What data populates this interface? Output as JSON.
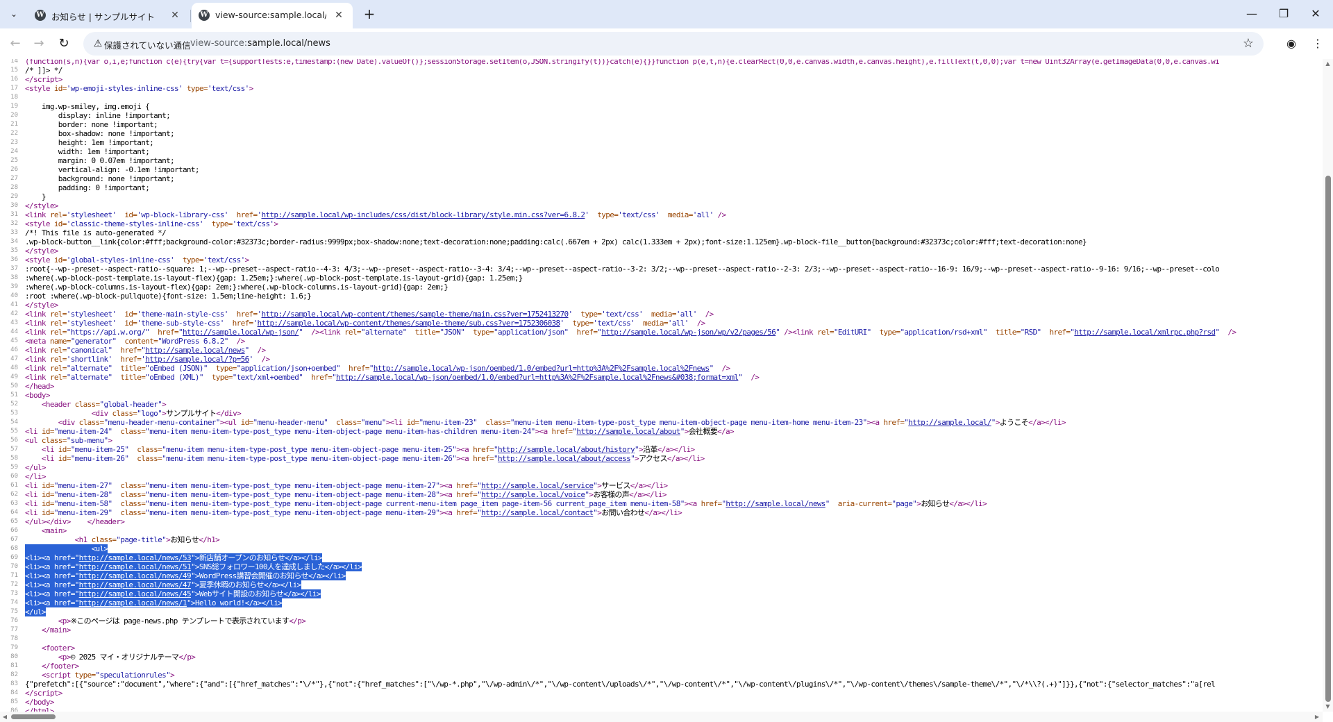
{
  "tabs": [
    {
      "title": "お知らせ | サンプルサイト",
      "favicon": "wordpress-icon",
      "active": false
    },
    {
      "title": "view-source:sample.local/news",
      "favicon": "wordpress-icon",
      "active": true
    }
  ],
  "toolbar": {
    "security_label": "保護されていない通信",
    "url_prefix": "view-source:",
    "url_host": "sample.local/news",
    "icons": [
      "back-icon",
      "forward-icon",
      "reload-icon",
      "warning-icon",
      "bookmark-star-icon",
      "profile-icon",
      "menu-icon"
    ]
  },
  "source_lines": [
    {
      "n": "14",
      "html": "<span class=\"tg\">(function(s,n){var o,i,e;function c(e){try{var t={supportTests:e,timestamp:(new Date).valueOf()};sessionStorage.setItem(o,JSON.stringify(t))}catch(e){}}function p(e,t,n){e.clearRect(0,0,e.canvas.width,e.canvas.height),e.fillText(t,0,0);var t=new Uint32Array(e.getImageData(0,0,e.canvas.wi</span>"
    },
    {
      "n": "15",
      "html": "/* ]]> */"
    },
    {
      "n": "16",
      "html": "<span class=\"tg\">&lt;/script&gt;</span>"
    },
    {
      "n": "17",
      "html": "<span class=\"tg\">&lt;style </span><span class=\"at\">id=</span><span class=\"av\">'wp-emoji-styles-inline-css'</span> <span class=\"at\">type=</span><span class=\"av\">'text/css'</span><span class=\"tg\">&gt;</span>"
    },
    {
      "n": "18",
      "html": ""
    },
    {
      "n": "19",
      "html": "    img.wp-smiley, img.emoji {"
    },
    {
      "n": "20",
      "html": "        display: inline !important;"
    },
    {
      "n": "21",
      "html": "        border: none !important;"
    },
    {
      "n": "22",
      "html": "        box-shadow: none !important;"
    },
    {
      "n": "23",
      "html": "        height: 1em !important;"
    },
    {
      "n": "24",
      "html": "        width: 1em !important;"
    },
    {
      "n": "25",
      "html": "        margin: 0 0.07em !important;"
    },
    {
      "n": "26",
      "html": "        vertical-align: -0.1em !important;"
    },
    {
      "n": "27",
      "html": "        background: none !important;"
    },
    {
      "n": "28",
      "html": "        padding: 0 !important;"
    },
    {
      "n": "29",
      "html": "    }"
    },
    {
      "n": "30",
      "html": "<span class=\"tg\">&lt;/style&gt;</span>"
    },
    {
      "n": "31",
      "html": "<span class=\"tg\">&lt;link </span><span class=\"at\">rel=</span><span class=\"av\">'stylesheet'</span>  <span class=\"at\">id=</span><span class=\"av\">'wp-block-library-css'</span>  <span class=\"at\">href=</span><span class=\"av\">'</span><span class=\"lk\">http://sample.local/wp-includes/css/dist/block-library/style.min.css?ver=6.8.2</span><span class=\"av\">'</span>  <span class=\"at\">type=</span><span class=\"av\">'text/css'</span>  <span class=\"at\">media=</span><span class=\"av\">'all'</span> <span class=\"tg\">/&gt;</span>"
    },
    {
      "n": "32",
      "html": "<span class=\"tg\">&lt;style </span><span class=\"at\">id=</span><span class=\"av\">'classic-theme-styles-inline-css'</span>  <span class=\"at\">type=</span><span class=\"av\">'text/css'</span><span class=\"tg\">&gt;</span>"
    },
    {
      "n": "33",
      "html": "/*! This file is auto-generated */"
    },
    {
      "n": "34",
      "html": ".wp-block-button__link{color:#fff;background-color:#32373c;border-radius:9999px;box-shadow:none;text-decoration:none;padding:calc(.667em + 2px) calc(1.333em + 2px);font-size:1.125em}.wp-block-file__button{background:#32373c;color:#fff;text-decoration:none}"
    },
    {
      "n": "35",
      "html": "<span class=\"tg\">&lt;/style&gt;</span>"
    },
    {
      "n": "36",
      "html": "<span class=\"tg\">&lt;style </span><span class=\"at\">id=</span><span class=\"av\">'global-styles-inline-css'</span>  <span class=\"at\">type=</span><span class=\"av\">'text/css'</span><span class=\"tg\">&gt;</span>"
    },
    {
      "n": "37",
      "html": ":root{--wp--preset--aspect-ratio--square: 1;--wp--preset--aspect-ratio--4-3: 4/3;--wp--preset--aspect-ratio--3-4: 3/4;--wp--preset--aspect-ratio--3-2: 3/2;--wp--preset--aspect-ratio--2-3: 2/3;--wp--preset--aspect-ratio--16-9: 16/9;--wp--preset--aspect-ratio--9-16: 9/16;--wp--preset--colo"
    },
    {
      "n": "38",
      "html": ":where(.wp-block-post-template.is-layout-flex){gap: 1.25em;}:where(.wp-block-post-template.is-layout-grid){gap: 1.25em;}"
    },
    {
      "n": "39",
      "html": ":where(.wp-block-columns.is-layout-flex){gap: 2em;}:where(.wp-block-columns.is-layout-grid){gap: 2em;}"
    },
    {
      "n": "40",
      "html": ":root :where(.wp-block-pullquote){font-size: 1.5em;line-height: 1.6;}"
    },
    {
      "n": "41",
      "html": "<span class=\"tg\">&lt;/style&gt;</span>"
    },
    {
      "n": "42",
      "html": "<span class=\"tg\">&lt;link </span><span class=\"at\">rel=</span><span class=\"av\">'stylesheet'</span>  <span class=\"at\">id=</span><span class=\"av\">'theme-main-style-css'</span>  <span class=\"at\">href=</span><span class=\"av\">'</span><span class=\"lk\">http://sample.local/wp-content/themes/sample-theme/main.css?ver=1752413270</span><span class=\"av\">'</span>  <span class=\"at\">type=</span><span class=\"av\">'text/css'</span>  <span class=\"at\">media=</span><span class=\"av\">'all'</span>  <span class=\"tg\">/&gt;</span>"
    },
    {
      "n": "43",
      "html": "<span class=\"tg\">&lt;link </span><span class=\"at\">rel=</span><span class=\"av\">'stylesheet'</span>  <span class=\"at\">id=</span><span class=\"av\">'theme-sub-style-css'</span>  <span class=\"at\">href=</span><span class=\"av\">'</span><span class=\"lk\">http://sample.local/wp-content/themes/sample-theme/sub.css?ver=1752306038</span><span class=\"av\">'</span>  <span class=\"at\">type=</span><span class=\"av\">'text/css'</span>  <span class=\"at\">media=</span><span class=\"av\">'all'</span>  <span class=\"tg\">/&gt;</span>"
    },
    {
      "n": "44",
      "html": "<span class=\"tg\">&lt;link </span><span class=\"at\">rel=</span><span class=\"av\">\"https://api.w.org/\"</span>  <span class=\"at\">href=</span><span class=\"av\">\"</span><span class=\"lk\">http://sample.local/wp-json/</span><span class=\"av\">\"</span>  <span class=\"tg\">/&gt;&lt;link </span><span class=\"at\">rel=</span><span class=\"av\">\"alternate\"</span>  <span class=\"at\">title=</span><span class=\"av\">\"JSON\"</span>  <span class=\"at\">type=</span><span class=\"av\">\"application/json\"</span>  <span class=\"at\">href=</span><span class=\"av\">\"</span><span class=\"lk\">http://sample.local/wp-json/wp/v2/pages/56</span><span class=\"av\">\"</span> <span class=\"tg\">/&gt;&lt;link </span><span class=\"at\">rel=</span><span class=\"av\">\"EditURI\"</span>  <span class=\"at\">type=</span><span class=\"av\">\"application/rsd+xml\"</span>  <span class=\"at\">title=</span><span class=\"av\">\"RSD\"</span>  <span class=\"at\">href=</span><span class=\"av\">\"</span><span class=\"lk\">http://sample.local/xmlrpc.php?rsd</span><span class=\"av\">\"</span>  <span class=\"tg\">/&gt;</span>"
    },
    {
      "n": "45",
      "html": "<span class=\"tg\">&lt;meta </span><span class=\"at\">name=</span><span class=\"av\">\"generator\"</span>  <span class=\"at\">content=</span><span class=\"av\">\"WordPress 6.8.2\"</span>  <span class=\"tg\">/&gt;</span>"
    },
    {
      "n": "46",
      "html": "<span class=\"tg\">&lt;link </span><span class=\"at\">rel=</span><span class=\"av\">\"canonical\"</span>  <span class=\"at\">href=</span><span class=\"av\">\"</span><span class=\"lk\">http://sample.local/news</span><span class=\"av\">\"</span>  <span class=\"tg\">/&gt;</span>"
    },
    {
      "n": "47",
      "html": "<span class=\"tg\">&lt;link </span><span class=\"at\">rel=</span><span class=\"av\">'shortlink'</span>  <span class=\"at\">href=</span><span class=\"av\">'</span><span class=\"lk\">http://sample.local/?p=56</span><span class=\"av\">'</span>  <span class=\"tg\">/&gt;</span>"
    },
    {
      "n": "48",
      "html": "<span class=\"tg\">&lt;link </span><span class=\"at\">rel=</span><span class=\"av\">\"alternate\"</span>  <span class=\"at\">title=</span><span class=\"av\">\"oEmbed (JSON)\"</span>  <span class=\"at\">type=</span><span class=\"av\">\"application/json+oembed\"</span>  <span class=\"at\">href=</span><span class=\"av\">\"</span><span class=\"lk\">http://sample.local/wp-json/oembed/1.0/embed?url=http%3A%2F%2Fsample.local%2Fnews</span><span class=\"av\">\"</span>  <span class=\"tg\">/&gt;</span>"
    },
    {
      "n": "49",
      "html": "<span class=\"tg\">&lt;link </span><span class=\"at\">rel=</span><span class=\"av\">\"alternate\"</span>  <span class=\"at\">title=</span><span class=\"av\">\"oEmbed (XML)\"</span>  <span class=\"at\">type=</span><span class=\"av\">\"text/xml+oembed\"</span>  <span class=\"at\">href=</span><span class=\"av\">\"</span><span class=\"lk\">http://sample.local/wp-json/oembed/1.0/embed?url=http%3A%2F%2Fsample.local%2Fnews&amp;#038;format=xml</span><span class=\"av\">\"</span>  <span class=\"tg\">/&gt;</span>"
    },
    {
      "n": "50",
      "html": "<span class=\"tg\">&lt;/head&gt;</span>"
    },
    {
      "n": "51",
      "html": "<span class=\"tg\">&lt;body&gt;</span>"
    },
    {
      "n": "52",
      "html": "    <span class=\"tg\">&lt;header </span><span class=\"at\">class=</span><span class=\"av\">\"global-header\"</span><span class=\"tg\">&gt;</span>"
    },
    {
      "n": "53",
      "html": "                <span class=\"tg\">&lt;div </span><span class=\"at\">class=</span><span class=\"av\">\"logo\"</span><span class=\"tg\">&gt;</span>サンプルサイト<span class=\"tg\">&lt;/div&gt;</span>"
    },
    {
      "n": "54",
      "html": "        <span class=\"tg\">&lt;div </span><span class=\"at\">class=</span><span class=\"av\">\"menu-header-menu-container\"</span><span class=\"tg\">&gt;&lt;ul </span><span class=\"at\">id=</span><span class=\"av\">\"menu-header-menu\"</span>  <span class=\"at\">class=</span><span class=\"av\">\"menu\"</span><span class=\"tg\">&gt;&lt;li </span><span class=\"at\">id=</span><span class=\"av\">\"menu-item-23\"</span>  <span class=\"at\">class=</span><span class=\"av\">\"menu-item menu-item-type-post_type menu-item-object-page menu-item-home menu-item-23\"</span><span class=\"tg\">&gt;&lt;a </span><span class=\"at\">href=</span><span class=\"av\">\"</span><span class=\"lk\">http://sample.local/</span><span class=\"av\">\"</span><span class=\"tg\">&gt;</span>ようこそ<span class=\"tg\">&lt;/a&gt;&lt;/li&gt;</span>"
    },
    {
      "n": "55",
      "html": "<span class=\"tg\">&lt;li </span><span class=\"at\">id=</span><span class=\"av\">\"menu-item-24\"</span>  <span class=\"at\">class=</span><span class=\"av\">\"menu-item menu-item-type-post_type menu-item-object-page menu-item-has-children menu-item-24\"</span><span class=\"tg\">&gt;&lt;a </span><span class=\"at\">href=</span><span class=\"av\">\"</span><span class=\"lk\">http://sample.local/about</span><span class=\"av\">\"</span><span class=\"tg\">&gt;</span>会社概要<span class=\"tg\">&lt;/a&gt;</span>"
    },
    {
      "n": "56",
      "html": "<span class=\"tg\">&lt;ul </span><span class=\"at\">class=</span><span class=\"av\">\"sub-menu\"</span><span class=\"tg\">&gt;</span>"
    },
    {
      "n": "57",
      "html": "    <span class=\"tg\">&lt;li </span><span class=\"at\">id=</span><span class=\"av\">\"menu-item-25\"</span>  <span class=\"at\">class=</span><span class=\"av\">\"menu-item menu-item-type-post_type menu-item-object-page menu-item-25\"</span><span class=\"tg\">&gt;&lt;a </span><span class=\"at\">href=</span><span class=\"av\">\"</span><span class=\"lk\">http://sample.local/about/history</span><span class=\"av\">\"</span><span class=\"tg\">&gt;</span>沿革<span class=\"tg\">&lt;/a&gt;&lt;/li&gt;</span>"
    },
    {
      "n": "58",
      "html": "    <span class=\"tg\">&lt;li </span><span class=\"at\">id=</span><span class=\"av\">\"menu-item-26\"</span>  <span class=\"at\">class=</span><span class=\"av\">\"menu-item menu-item-type-post_type menu-item-object-page menu-item-26\"</span><span class=\"tg\">&gt;&lt;a </span><span class=\"at\">href=</span><span class=\"av\">\"</span><span class=\"lk\">http://sample.local/about/access</span><span class=\"av\">\"</span><span class=\"tg\">&gt;</span>アクセス<span class=\"tg\">&lt;/a&gt;&lt;/li&gt;</span>"
    },
    {
      "n": "59",
      "html": "<span class=\"tg\">&lt;/ul&gt;</span>"
    },
    {
      "n": "60",
      "html": "<span class=\"tg\">&lt;/li&gt;</span>"
    },
    {
      "n": "61",
      "html": "<span class=\"tg\">&lt;li </span><span class=\"at\">id=</span><span class=\"av\">\"menu-item-27\"</span>  <span class=\"at\">class=</span><span class=\"av\">\"menu-item menu-item-type-post_type menu-item-object-page menu-item-27\"</span><span class=\"tg\">&gt;&lt;a </span><span class=\"at\">href=</span><span class=\"av\">\"</span><span class=\"lk\">http://sample.local/service</span><span class=\"av\">\"</span><span class=\"tg\">&gt;</span>サービス<span class=\"tg\">&lt;/a&gt;&lt;/li&gt;</span>"
    },
    {
      "n": "62",
      "html": "<span class=\"tg\">&lt;li </span><span class=\"at\">id=</span><span class=\"av\">\"menu-item-28\"</span>  <span class=\"at\">class=</span><span class=\"av\">\"menu-item menu-item-type-post_type menu-item-object-page menu-item-28\"</span><span class=\"tg\">&gt;&lt;a </span><span class=\"at\">href=</span><span class=\"av\">\"</span><span class=\"lk\">http://sample.local/voice</span><span class=\"av\">\"</span><span class=\"tg\">&gt;</span>お客様の声<span class=\"tg\">&lt;/a&gt;&lt;/li&gt;</span>"
    },
    {
      "n": "63",
      "html": "<span class=\"tg\">&lt;li </span><span class=\"at\">id=</span><span class=\"av\">\"menu-item-58\"</span>  <span class=\"at\">class=</span><span class=\"av\">\"menu-item menu-item-type-post_type menu-item-object-page current-menu-item page_item page-item-56 current_page_item menu-item-58\"</span><span class=\"tg\">&gt;&lt;a </span><span class=\"at\">href=</span><span class=\"av\">\"</span><span class=\"lk\">http://sample.local/news</span><span class=\"av\">\"</span>  <span class=\"at\">aria-current=</span><span class=\"av\">\"page\"</span><span class=\"tg\">&gt;</span>お知らせ<span class=\"tg\">&lt;/a&gt;&lt;/li&gt;</span>"
    },
    {
      "n": "64",
      "html": "<span class=\"tg\">&lt;li </span><span class=\"at\">id=</span><span class=\"av\">\"menu-item-29\"</span>  <span class=\"at\">class=</span><span class=\"av\">\"menu-item menu-item-type-post_type menu-item-object-page menu-item-29\"</span><span class=\"tg\">&gt;&lt;a </span><span class=\"at\">href=</span><span class=\"av\">\"</span><span class=\"lk\">http://sample.local/contact</span><span class=\"av\">\"</span><span class=\"tg\">&gt;</span>お問い合わせ<span class=\"tg\">&lt;/a&gt;&lt;/li&gt;</span>"
    },
    {
      "n": "65",
      "html": "<span class=\"tg\">&lt;/ul&gt;&lt;/div&gt;</span>    <span class=\"tg\">&lt;/header&gt;</span>"
    },
    {
      "n": "66",
      "html": "    <span class=\"tg\">&lt;main&gt;</span>"
    },
    {
      "n": "67",
      "html": "            <span class=\"tg\">&lt;h1 </span><span class=\"at\">class=</span><span class=\"av\">\"page-title\"</span><span class=\"tg\">&gt;</span>お知らせ<span class=\"tg\">&lt;/h1&gt;</span>"
    },
    {
      "n": "68",
      "html": "                <span class=\"tg\">&lt;ul&gt;</span>",
      "sel": true
    },
    {
      "n": "69",
      "html": "<span class=\"tg\">&lt;li&gt;&lt;a </span><span class=\"at\">href=</span><span class=\"av\">\"</span><span class=\"lk\">http://sample.local/news/53</span><span class=\"av\">\"</span><span class=\"tg\">&gt;</span>新店舗オープンのお知らせ<span class=\"tg\">&lt;/a&gt;&lt;/li&gt;</span>",
      "sel": true
    },
    {
      "n": "70",
      "html": "<span class=\"tg\">&lt;li&gt;&lt;a </span><span class=\"at\">href=</span><span class=\"av\">\"</span><span class=\"lk\">http://sample.local/news/51</span><span class=\"av\">\"</span><span class=\"tg\">&gt;</span>SNS総フォロワー100人を達成しました<span class=\"tg\">&lt;/a&gt;&lt;/li&gt;</span>",
      "sel": true
    },
    {
      "n": "71",
      "html": "<span class=\"tg\">&lt;li&gt;&lt;a </span><span class=\"at\">href=</span><span class=\"av\">\"</span><span class=\"lk\">http://sample.local/news/49</span><span class=\"av\">\"</span><span class=\"tg\">&gt;</span>WordPress講習会開催のお知らせ<span class=\"tg\">&lt;/a&gt;&lt;/li&gt;</span>",
      "sel": true
    },
    {
      "n": "72",
      "html": "<span class=\"tg\">&lt;li&gt;&lt;a </span><span class=\"at\">href=</span><span class=\"av\">\"</span><span class=\"lk\">http://sample.local/news/47</span><span class=\"av\">\"</span><span class=\"tg\">&gt;</span>夏季休暇のお知らせ<span class=\"tg\">&lt;/a&gt;&lt;/li&gt;</span>",
      "sel": true
    },
    {
      "n": "73",
      "html": "<span class=\"tg\">&lt;li&gt;&lt;a </span><span class=\"at\">href=</span><span class=\"av\">\"</span><span class=\"lk\">http://sample.local/news/45</span><span class=\"av\">\"</span><span class=\"tg\">&gt;</span>Webサイト開設のお知らせ<span class=\"tg\">&lt;/a&gt;&lt;/li&gt;</span>",
      "sel": true
    },
    {
      "n": "74",
      "html": "<span class=\"tg\">&lt;li&gt;&lt;a </span><span class=\"at\">href=</span><span class=\"av\">\"</span><span class=\"lk\">http://sample.local/news/1</span><span class=\"av\">\"</span><span class=\"tg\">&gt;</span>Hello world!<span class=\"tg\">&lt;/a&gt;&lt;/li&gt;</span>",
      "sel": true
    },
    {
      "n": "75",
      "html": "<span class=\"tg\">&lt;/ul&gt;</span>",
      "sel": true
    },
    {
      "n": "76",
      "html": "        <span class=\"tg\">&lt;p&gt;</span>※このページは page-news.php テンプレートで表示されています<span class=\"tg\">&lt;/p&gt;</span>"
    },
    {
      "n": "77",
      "html": "    <span class=\"tg\">&lt;/main&gt;</span>"
    },
    {
      "n": "78",
      "html": ""
    },
    {
      "n": "79",
      "html": "    <span class=\"tg\">&lt;footer&gt;</span>"
    },
    {
      "n": "80",
      "html": "        <span class=\"tg\">&lt;p&gt;</span>© 2025 マイ・オリジナルテーマ<span class=\"tg\">&lt;/p&gt;</span>"
    },
    {
      "n": "81",
      "html": "    <span class=\"tg\">&lt;/footer&gt;</span>"
    },
    {
      "n": "82",
      "html": "    <span class=\"tg\">&lt;script </span><span class=\"at\">type=</span><span class=\"av\">\"speculationrules\"</span><span class=\"tg\">&gt;</span>"
    },
    {
      "n": "83",
      "html": "{\"prefetch\":[{\"source\":\"document\",\"where\":{\"and\":[{\"href_matches\":\"\\/*\"},{\"not\":{\"href_matches\":[\"\\/wp-*.php\",\"\\/wp-admin\\/*\",\"\\/wp-content\\/uploads\\/*\",\"\\/wp-content\\/*\",\"\\/wp-content\\/plugins\\/*\",\"\\/wp-content\\/themes\\/sample-theme\\/*\",\"\\/*\\\\?(.+)\"]}},{\"not\":{\"selector_matches\":\"a[rel"
    },
    {
      "n": "84",
      "html": "<span class=\"tg\">&lt;/script&gt;</span>"
    },
    {
      "n": "85",
      "html": "<span class=\"tg\">&lt;/body&gt;</span>"
    },
    {
      "n": "86",
      "html": "<span class=\"tg\">&lt;/html&gt;</span>"
    }
  ]
}
